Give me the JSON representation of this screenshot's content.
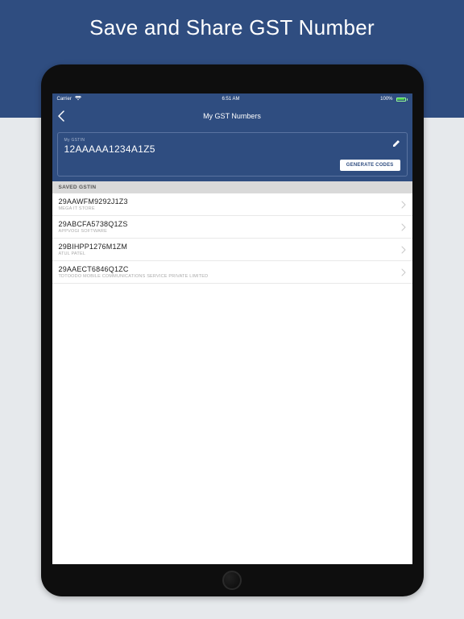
{
  "banner": {
    "title": "Save and Share GST Number"
  },
  "statusbar": {
    "carrier": "Carrier",
    "wifi": "",
    "time": "6:51 AM",
    "battery_pct": "100%"
  },
  "navbar": {
    "title": "My GST Numbers"
  },
  "card": {
    "label": "My GSTIN",
    "value": "12AAAAA1234A1Z5",
    "generate_label": "GENERATE CODES"
  },
  "section": {
    "header": "SAVED GSTIN"
  },
  "saved": [
    {
      "gstin": "29AAWFM9292J1Z3",
      "name": "MEGA IT STORE"
    },
    {
      "gstin": "29ABCFA5738Q1ZS",
      "name": "APPVOGI SOFTWARE"
    },
    {
      "gstin": "29BIHPP1276M1ZM",
      "name": "ATUL  PATEL"
    },
    {
      "gstin": "29AAECT6846Q1ZC",
      "name": "TDTOODO MOBILE COMMUNICATIONS SERVICE PRIVATE LIMITED"
    }
  ]
}
